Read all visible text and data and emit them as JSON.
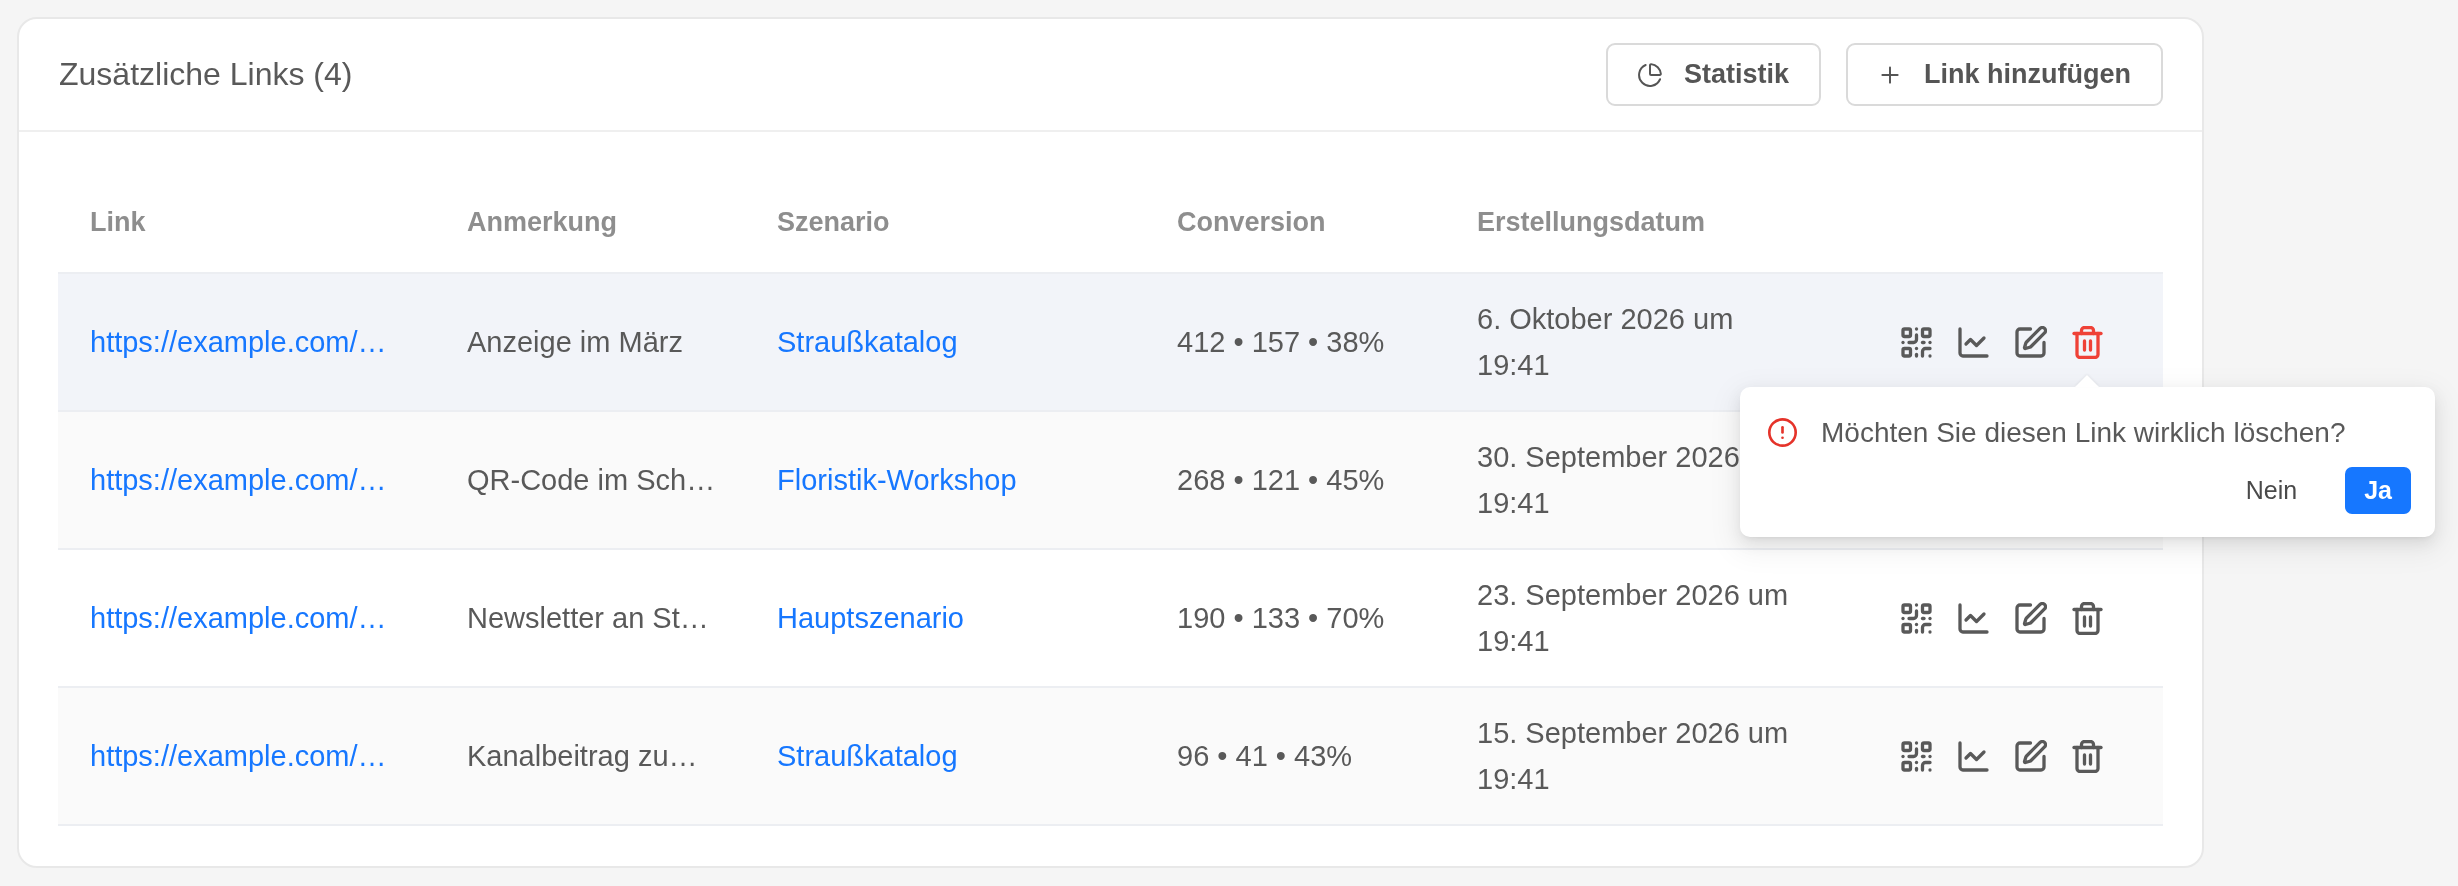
{
  "card": {
    "title": "Zusätzliche Links (4)",
    "buttons": [
      {
        "kind": "stats",
        "label": "Statistik"
      },
      {
        "kind": "add",
        "label": "Link hinzufügen"
      }
    ]
  },
  "table": {
    "columns": [
      "Link",
      "Anmerkung",
      "Szenario",
      "Conversion",
      "Erstellungsdatum"
    ],
    "rows": [
      {
        "link": "https://example.com/…",
        "note": "Anzeige im März",
        "scenario": "Straußkatalog",
        "conversion": "412 • 157 • 38%",
        "created_at": "6. Oktober 2026 um 19:41",
        "delete_open": true
      },
      {
        "link": "https://example.com/…",
        "note": "QR-Code im Sch…",
        "scenario": "Floristik-Workshop",
        "conversion": "268 • 121 • 45%",
        "created_at": "30. September 2026 19:41",
        "delete_open": false
      },
      {
        "link": "https://example.com/…",
        "note": "Newsletter an St…",
        "scenario": "Hauptszenario",
        "conversion": "190 • 133 • 70%",
        "created_at": "23. September 2026 um 19:41",
        "delete_open": false
      },
      {
        "link": "https://example.com/…",
        "note": "Kanalbeitrag zu…",
        "scenario": "Straußkatalog",
        "conversion": "96 • 41 • 43%",
        "created_at": "15. September 2026 um 19:41",
        "delete_open": false
      }
    ]
  },
  "delete_confirm": {
    "message": "Möchten Sie diesen Link wirklich löschen?",
    "cancel": "Nein",
    "confirm": "Ja"
  }
}
